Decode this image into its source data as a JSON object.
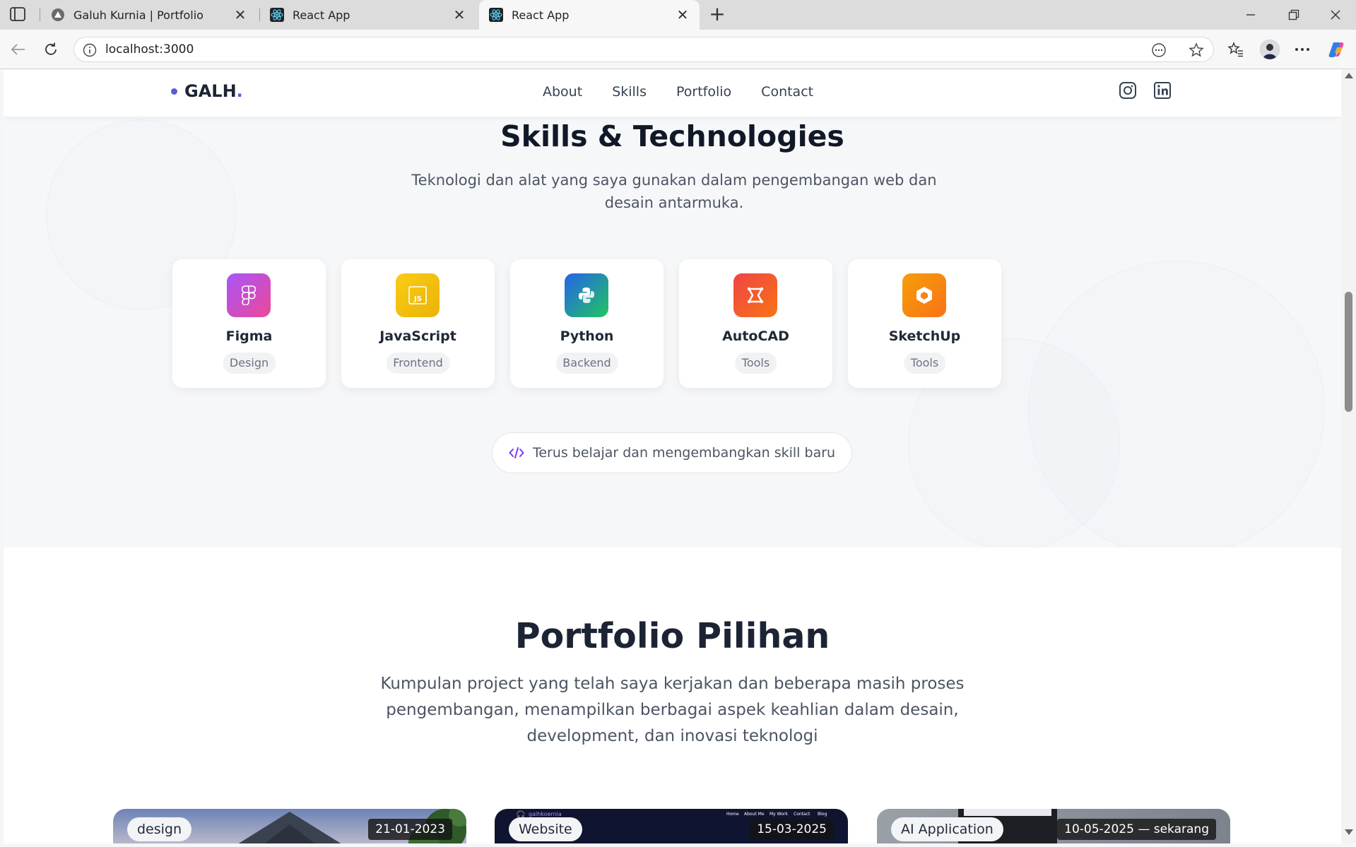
{
  "browser": {
    "tabs": [
      {
        "title": "Galuh Kurnia | Portfolio",
        "active": false,
        "icon": "triangle-favicon"
      },
      {
        "title": "React App",
        "active": false,
        "icon": "react-favicon"
      },
      {
        "title": "React App",
        "active": true,
        "icon": "react-favicon"
      }
    ],
    "url": "localhost:3000"
  },
  "site": {
    "logo": "GALH",
    "logo_period": ".",
    "nav": [
      "About",
      "Skills",
      "Portfolio",
      "Contact"
    ],
    "social": [
      "instagram-icon",
      "linkedin-icon"
    ]
  },
  "skills": {
    "title": "Skills & Technologies",
    "subtitle": "Teknologi dan alat yang saya gunakan dalam pengembangan web dan desain antarmuka.",
    "items": [
      {
        "name": "Figma",
        "category": "Design",
        "icon": "figma-icon",
        "color": "#c44de6"
      },
      {
        "name": "JavaScript",
        "category": "Frontend",
        "icon": "javascript-icon",
        "color": "#f5c518"
      },
      {
        "name": "Python",
        "category": "Backend",
        "icon": "python-icon",
        "color": "#2a86e0"
      },
      {
        "name": "AutoCAD",
        "category": "Tools",
        "icon": "autocad-icon",
        "color": "#ee4535"
      },
      {
        "name": "SketchUp",
        "category": "Tools",
        "icon": "sketchup-icon",
        "color": "#f7851a"
      }
    ],
    "learning": "Terus belajar dan mengembangkan skill baru"
  },
  "portfolio": {
    "title": "Portfolio Pilihan",
    "subtitle": "Kumpulan project yang telah saya kerjakan dan beberapa masih proses pengembangan, menampilkan berbagai aspek keahlian dalam desain, development, dan inovasi teknologi",
    "projects": [
      {
        "tag": "design",
        "date": "21-01-2023"
      },
      {
        "tag": "Website",
        "date": "15-03-2025",
        "thumb_brand": "galhkoernia",
        "thumb_nav": [
          "Home",
          "About Me",
          "My Work",
          "Contact",
          "Blog"
        ]
      },
      {
        "tag": "AI Application",
        "date": "10-05-2025 — sekarang"
      }
    ]
  }
}
